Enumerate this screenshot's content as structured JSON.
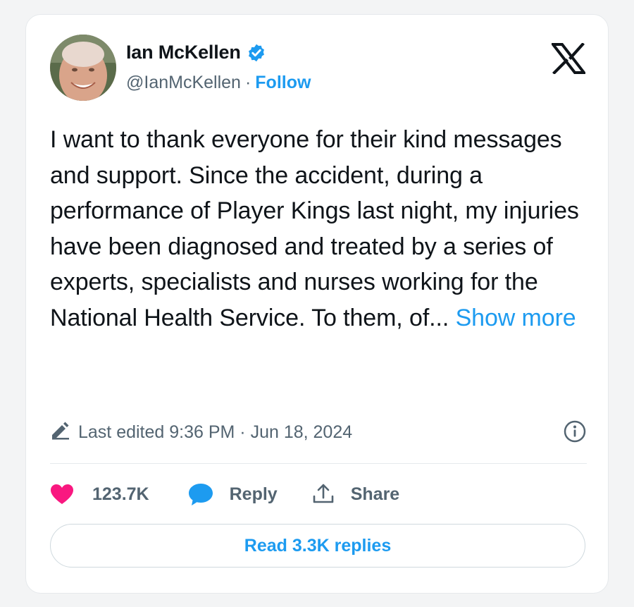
{
  "user": {
    "display_name": "Ian McKellen",
    "handle": "@IanMcKellen",
    "separator": "·",
    "follow_label": "Follow",
    "verified_icon": "verified-badge-icon",
    "avatar_icon": "profile-photo"
  },
  "tweet": {
    "text": "I want to thank everyone for their kind messages and support. Since the accident, during a performance of Player Kings last night, my injuries have been diagnosed and treated by a series of experts, specialists and nurses working for the National Health Service. To them, of...",
    "show_more_label": "Show more",
    "edited_text": "Last edited 9:36 PM · Jun 18, 2024"
  },
  "actions": {
    "likes_count": "123.7K",
    "reply_label": "Reply",
    "share_label": "Share",
    "read_replies_label": "Read 3.3K replies"
  },
  "icons": {
    "platform_logo": "x-logo-icon",
    "edit": "pencil-icon",
    "info": "info-icon",
    "like": "heart-icon",
    "reply": "speech-bubble-icon",
    "share": "share-icon"
  },
  "colors": {
    "accent": "#1d9bf0",
    "like": "#f91880",
    "text": "#0f1419",
    "secondary_text": "#536471",
    "border": "#e6e9ec"
  }
}
